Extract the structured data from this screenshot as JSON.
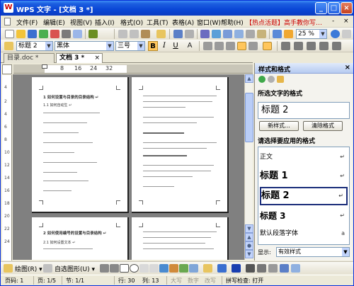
{
  "window": {
    "title": "WPS 文字 - [文档 3 *]",
    "buttons": {
      "minimize": "_",
      "maximize": "□",
      "close": "×"
    }
  },
  "menubar": {
    "items": [
      "文件(F)",
      "编辑(E)",
      "视图(V)",
      "插入(I)",
      "格式(O)",
      "工具(T)",
      "表格(A)",
      "窗口(W)",
      "帮助(H)"
    ],
    "promo": "【热点活题】高手教你写…",
    "right_controls": [
      "-",
      "×"
    ]
  },
  "toolbar2": {
    "zoom": "25 %"
  },
  "formatbar": {
    "style_value": "标题 2",
    "font_value": "黑体",
    "size_value": "三号",
    "bold": "B",
    "italic": "I",
    "underline": "U",
    "font_color": "A"
  },
  "tabs": [
    {
      "label": "目录.doc *",
      "close": "×"
    },
    {
      "label": "文档 3 *",
      "close": "×"
    }
  ],
  "ruler": {
    "numbers": [
      "8",
      "16",
      "24",
      "32"
    ],
    "vertical": [
      "4",
      "2",
      "4",
      "6",
      "8",
      "10",
      "12",
      "14",
      "16",
      "18",
      "20",
      "22",
      "24"
    ]
  },
  "document": {
    "page1_heading": "1 如何设置与目录的目录结构 ↵",
    "page1_sub": "1.1 如何自动生 ↵",
    "page3_heading": "2 如何使用编号的设置与目录结构 ↵",
    "page3_sub": "2.1 如何设置文本 ↵"
  },
  "panel": {
    "title": "样式和格式",
    "close": "×",
    "current_label": "所选文字的格式",
    "current_style": "标题 2",
    "new_button": "新样式...",
    "clear_button": "清除格式",
    "apply_label": "请选择要应用的格式",
    "styles": [
      {
        "name": "正文",
        "mark": "↵"
      },
      {
        "name": "标题 1",
        "mark": "↵"
      },
      {
        "name": "标题 2",
        "mark": "↵"
      },
      {
        "name": "标题 3",
        "mark": "↵"
      },
      {
        "name": "默认段落字体",
        "mark": "a"
      }
    ],
    "show_label": "显示:",
    "show_value": "有效样式"
  },
  "drawbar": {
    "draw_label": "绘图(R) ▾",
    "autoshape_label": "自选图形(U) ▾"
  },
  "status": {
    "page_num": "页码: 1",
    "pages": "页: 1/5",
    "section": "节: 1/1",
    "row": "行: 30",
    "col": "列: 13",
    "caps": "大写",
    "num": "数字",
    "ovr": "改写",
    "spell": "拼写检查: 打开"
  },
  "colors": {
    "title_blue": "#0a46d6",
    "accent_orange": "#ffc65c",
    "promo_red": "#cc0000"
  }
}
